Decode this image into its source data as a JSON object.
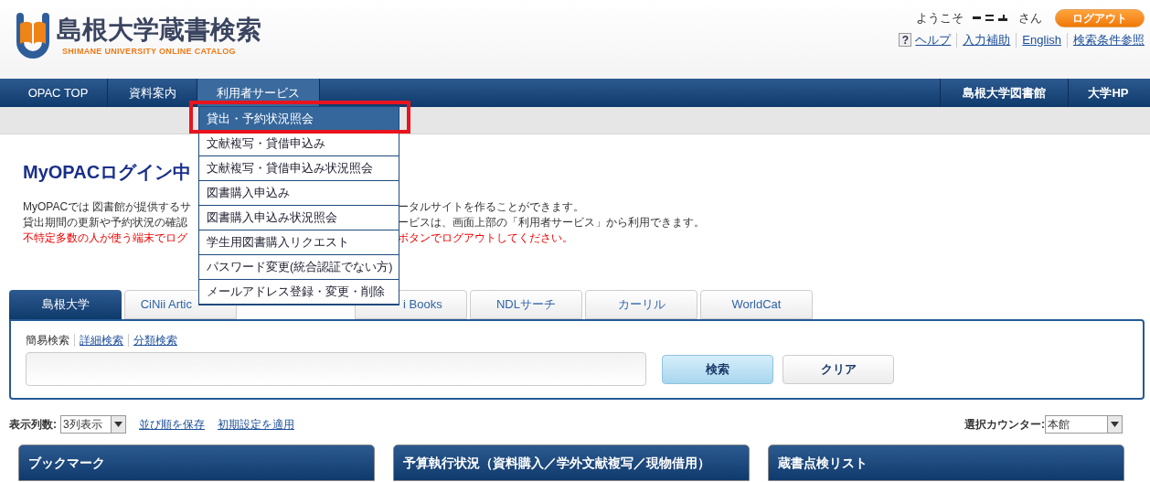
{
  "header": {
    "title": "島根大学蔵書検索",
    "subtitle": "SHIMANE UNIVERSITY ONLINE CATALOG",
    "welcome": "ようこそ",
    "honorific": "さん",
    "logout": "ログアウト",
    "help_icon": "?",
    "links": [
      "ヘルプ",
      "入力補助",
      "English",
      "検索条件参照"
    ]
  },
  "nav": {
    "left": [
      {
        "label": "OPAC TOP",
        "selected": false
      },
      {
        "label": "資料案内",
        "selected": false
      },
      {
        "label": "利用者サービス",
        "selected": true
      }
    ],
    "right": [
      "島根大学図書館",
      "大学HP"
    ]
  },
  "menu": [
    {
      "label": "貸出・予約状況照会",
      "selected": true
    },
    {
      "label": "文献複写・貸借申込み",
      "selected": false
    },
    {
      "label": "文献複写・貸借申込み状況照会",
      "selected": false
    },
    {
      "label": "図書購入申込み",
      "selected": false
    },
    {
      "label": "図書購入申込み状況照会",
      "selected": false
    },
    {
      "label": "学生用図書購入リクエスト",
      "selected": false
    },
    {
      "label": "パスワード変更(統合認証でない方)",
      "selected": false
    },
    {
      "label": "メールアドレス登録・変更・削除",
      "selected": false
    }
  ],
  "heading": "MyOPACログイン中",
  "lines": [
    {
      "left": "MyOPACでは 図書館が提供するサ",
      "right": "ータルサイトを作ることができます。",
      "warning": false
    },
    {
      "left": "貸出期間の更新や予約状況の確認",
      "right": "ービスは、画面上部の「利用者サービス」から利用できます。",
      "warning": false
    },
    {
      "left": "不特定多数の人が使う端末でログ",
      "right": "ボタンでログアウトしてください。",
      "warning": true
    }
  ],
  "search_tabs": [
    {
      "label": "島根大学",
      "selected": true
    },
    {
      "label": "CiNii Artic",
      "selected": false
    },
    {
      "label": "i Books",
      "selected": false
    },
    {
      "label": "NDLサーチ",
      "selected": false
    },
    {
      "label": "カーリル",
      "selected": false
    },
    {
      "label": "WorldCat",
      "selected": false
    }
  ],
  "search_modes": [
    {
      "label": "簡易検索",
      "selected": true
    },
    {
      "label": "詳細検索",
      "selected": false
    },
    {
      "label": "分類検索",
      "selected": false
    }
  ],
  "search_button": "検索",
  "clear_button": "クリア",
  "toolbar": {
    "columns_label": "表示列数:",
    "columns_value": "3列表示",
    "save_order": "並び順を保存",
    "apply_defaults": "初期設定を適用",
    "counter_label": "選択カウンター:",
    "counter_value": "本館"
  },
  "panels": [
    "ブックマーク",
    "予算執行状況（資料購入／学外文献複写／現物借用）",
    "蔵書点検リスト"
  ]
}
